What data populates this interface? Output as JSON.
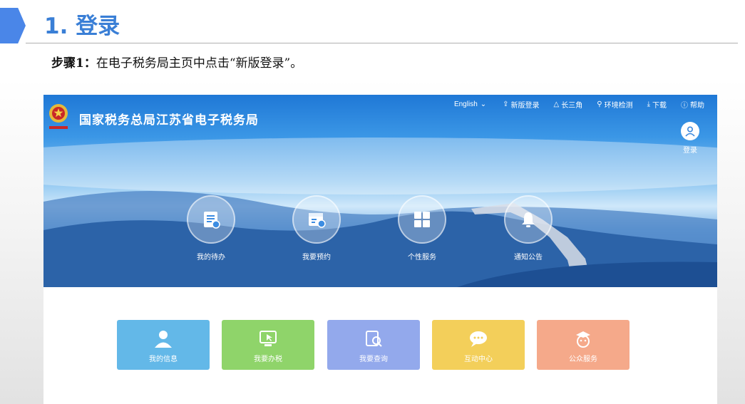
{
  "slide": {
    "heading": "1. 登录",
    "step_prefix": "步骤1：",
    "step_text": "在电子税务局主页中点击“新版登录”。"
  },
  "site": {
    "title": "国家税务总局江苏省电子税务局",
    "nav": [
      {
        "label": "English",
        "icon": "chevron-down-icon"
      },
      {
        "label": "新版登录",
        "icon": "login-icon"
      },
      {
        "label": "长三角",
        "icon": "triangle-icon"
      },
      {
        "label": "环境检测",
        "icon": "wrench-icon"
      },
      {
        "label": "下载",
        "icon": "download-icon"
      },
      {
        "label": "帮助",
        "icon": "help-icon"
      }
    ],
    "login_label": "登录",
    "quick": [
      {
        "label": "我的待办",
        "icon": "todo-list-icon"
      },
      {
        "label": "我要预约",
        "icon": "calendar-clock-icon"
      },
      {
        "label": "个性服务",
        "icon": "grid-icon"
      },
      {
        "label": "通知公告",
        "icon": "bell-icon"
      }
    ],
    "cards": [
      {
        "label": "我的信息",
        "icon": "user-icon",
        "color": "#63b8e8"
      },
      {
        "label": "我要办税",
        "icon": "monitor-cursor-icon",
        "color": "#8fd46a"
      },
      {
        "label": "我要查询",
        "icon": "search-document-icon",
        "color": "#93a9ec"
      },
      {
        "label": "互动中心",
        "icon": "chat-bubble-icon",
        "color": "#f3cf5a"
      },
      {
        "label": "公众服务",
        "icon": "mascot-icon",
        "color": "#f5a98a"
      }
    ]
  }
}
